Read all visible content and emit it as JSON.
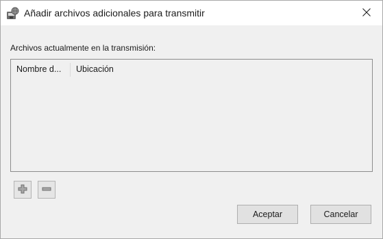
{
  "window": {
    "title": "Añadir archivos adicionales para transmitir",
    "icon": "stream-disk-icon",
    "close_icon": "close-icon"
  },
  "files_section": {
    "label": "Archivos actualmente en la transmisión:",
    "columns": [
      "Nombre d...",
      "Ubicación"
    ],
    "rows": []
  },
  "list_actions": {
    "add_icon": "plus-icon",
    "remove_icon": "minus-icon"
  },
  "buttons": {
    "ok_label": "Aceptar",
    "cancel_label": "Cancelar"
  }
}
